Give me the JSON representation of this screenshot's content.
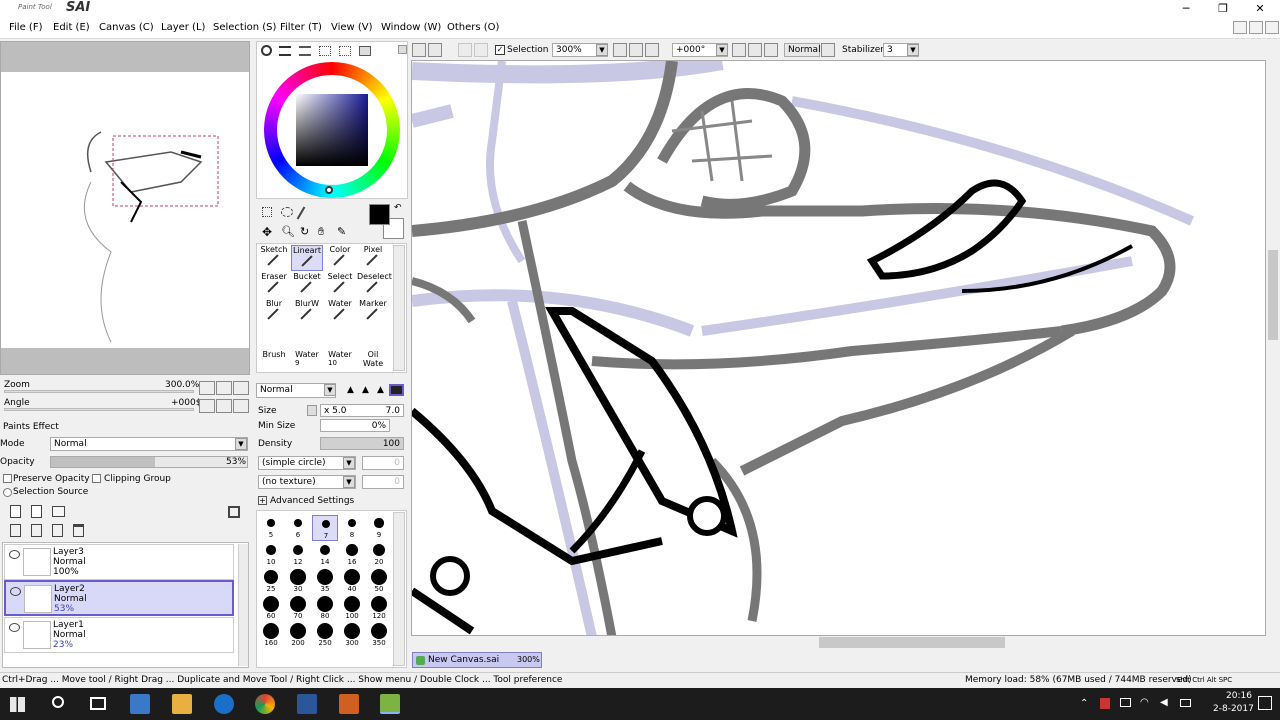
{
  "app": {
    "title": "PaintTool SAI",
    "brand_small": "Paint Tool",
    "brand_big": "SAI"
  },
  "menu": [
    "File (F)",
    "Edit (E)",
    "Canvas (C)",
    "Layer (L)",
    "Selection (S)",
    "Filter (T)",
    "View (V)",
    "Window (W)",
    "Others (O)"
  ],
  "navigator": {
    "zoom_label": "Zoom",
    "zoom_value": "300.0%",
    "angle_label": "Angle",
    "angle_value": "+000$"
  },
  "layer_panel": {
    "paints_effect": "Paints Effect",
    "mode_label": "Mode",
    "mode_value": "Normal",
    "opacity_label": "Opacity",
    "opacity_value": "53%",
    "opacity_fill": 0.53,
    "preserve_opacity": "Preserve Opacity",
    "clipping_group": "Clipping Group",
    "selection_source": "Selection Source",
    "layers": [
      {
        "name": "Layer3",
        "mode": "Normal",
        "opacity": "100%"
      },
      {
        "name": "Layer2",
        "mode": "Normal",
        "opacity": "53%"
      },
      {
        "name": "Layer1",
        "mode": "Normal",
        "opacity": "23%"
      }
    ]
  },
  "tools": {
    "row1": [
      "Sketch",
      "Lineart",
      "Color",
      "Pixel"
    ],
    "row2": [
      "Eraser",
      "Bucket",
      "Select",
      "Deselect"
    ],
    "row3": [
      "Blur",
      "BlurW",
      "Water",
      "Marker"
    ],
    "row4": [
      {
        "name": "Brush",
        "num": ""
      },
      {
        "name": "Water",
        "num": "9"
      },
      {
        "name": "Water",
        "num": "10"
      },
      {
        "name": "Oil Wate",
        "num": ""
      }
    ]
  },
  "brush": {
    "blend": "Normal",
    "size_label": "Size",
    "size_mult": "x 5.0",
    "size_value": "7.0",
    "minsize_label": "Min Size",
    "minsize_value": "0%",
    "density_label": "Density",
    "density_value": "100",
    "shape": "(simple circle)",
    "texture": "(no texture)",
    "shape_val": "0",
    "texture_val": "0",
    "advanced": "Advanced Settings",
    "sizes": [
      "5",
      "6",
      "7",
      "8",
      "9",
      "10",
      "12",
      "14",
      "16",
      "20",
      "25",
      "30",
      "35",
      "40",
      "50",
      "60",
      "70",
      "80",
      "100",
      "120",
      "160",
      "200",
      "250",
      "300",
      "350"
    ]
  },
  "toolbar": {
    "selection": "Selection",
    "zoom": "300%",
    "angle": "+000°",
    "mode": "Normal",
    "stabilizer_label": "Stabilizer",
    "stabilizer_value": "3"
  },
  "tab": {
    "name": "New Canvas.sai",
    "zoom": "300%"
  },
  "status": {
    "hint": "Ctrl+Drag ... Move tool / Right Drag ... Duplicate and Move Tool / Right Click ... Show menu / Double Clock ... Tool preference",
    "memory": "Memory load: 58% (67MB used / 744MB reserved)",
    "keys": "Shft Ctrl Alt SPC"
  },
  "clock": {
    "time": "20:16",
    "date": "2-8-2017"
  },
  "colors": {
    "accent": "#6a5acd",
    "canvas_stroke": "#777",
    "lavender": "#c8c8e4"
  }
}
